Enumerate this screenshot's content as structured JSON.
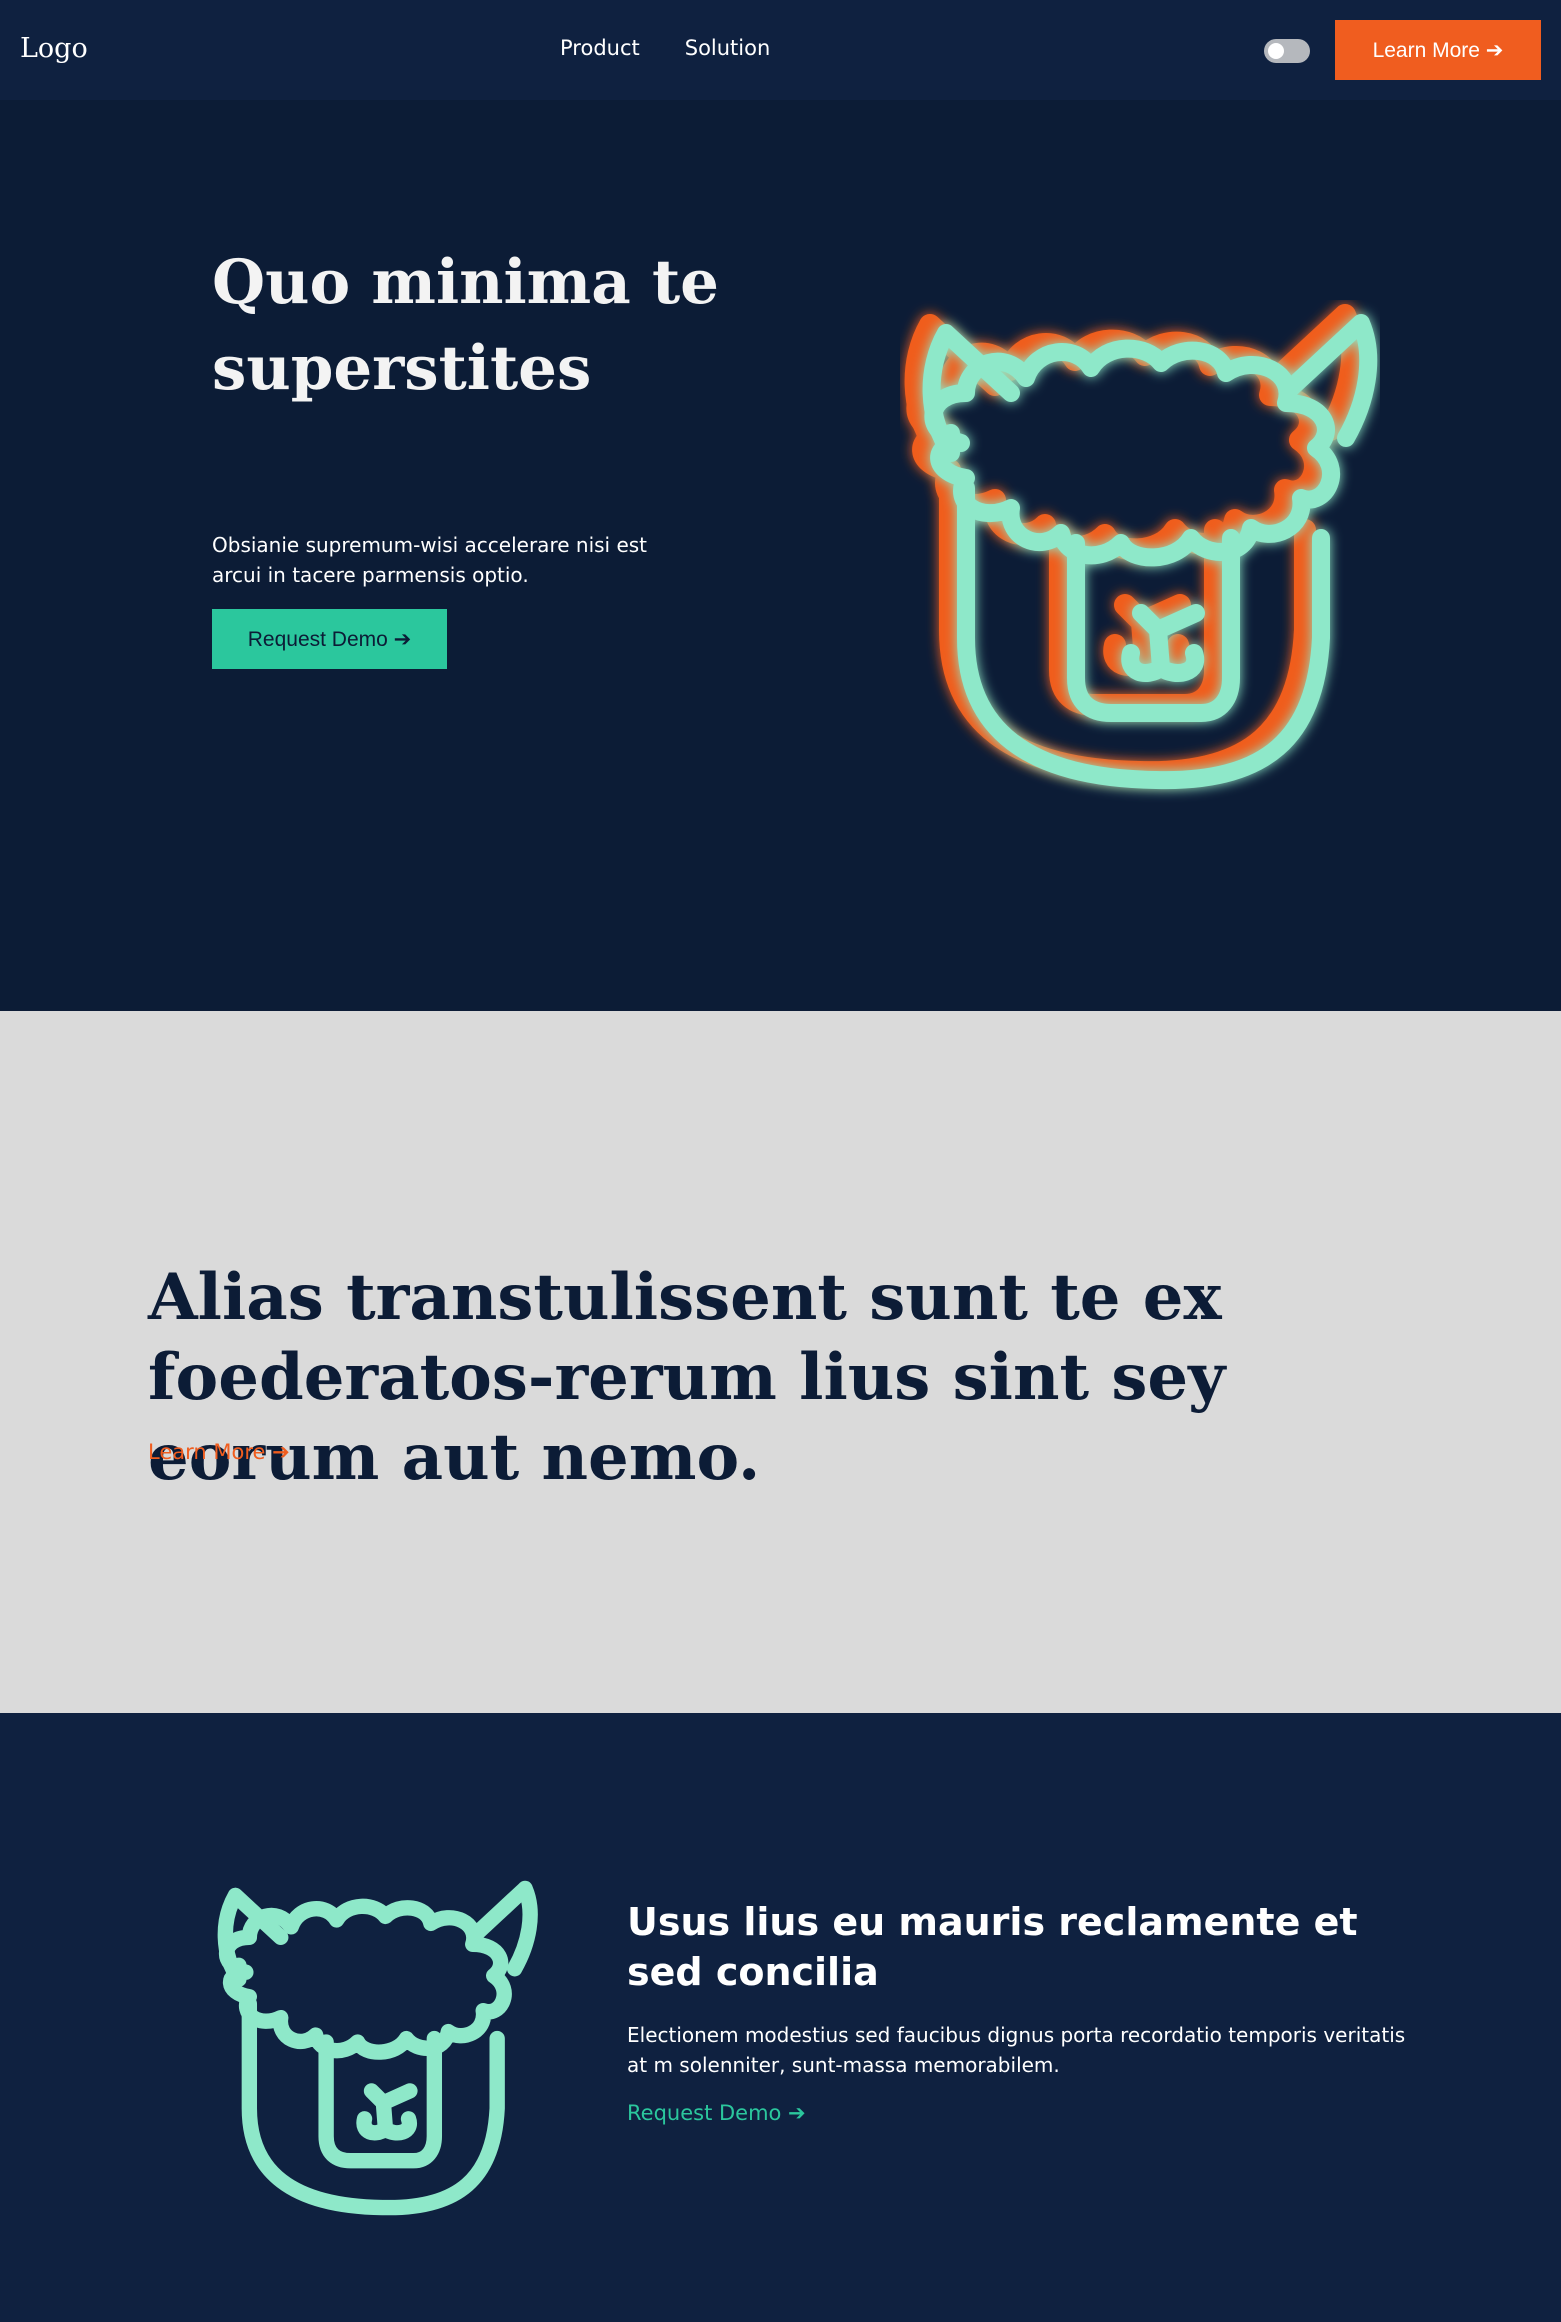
{
  "navbar": {
    "logo": "Logo",
    "links": [
      "Product",
      "Solution"
    ],
    "cta_label": "Learn More ➔"
  },
  "hero": {
    "title": "Quo minima te superstites",
    "subtitle": "Obsianie supremum-wisi accelerare nisi est arcui in tacere parmensis optio.",
    "button_label": "Request Demo ➔"
  },
  "band": {
    "title": "Alias transtulissent sunt te ex foederatos-rerum lius sint sey eorum aut nemo.",
    "link_label": "Learn More ➔"
  },
  "feature": {
    "title": "Usus lius eu mauris reclamente et sed concilia",
    "text": "Electionem modestius sed faucibus dignus porta recordatio temporis veritatis at m solenniter, sunt-massa memorabilem.",
    "link_label": "Request Demo ➔"
  },
  "icons": [
    "llama-icon",
    "llama-icon"
  ],
  "colors": {
    "navy": "#0c1c36",
    "navy_light": "#0f2140",
    "orange": "#f05d1f",
    "teal": "#2bc79d",
    "mint": "#8ee8c9",
    "gray": "#dadada"
  }
}
